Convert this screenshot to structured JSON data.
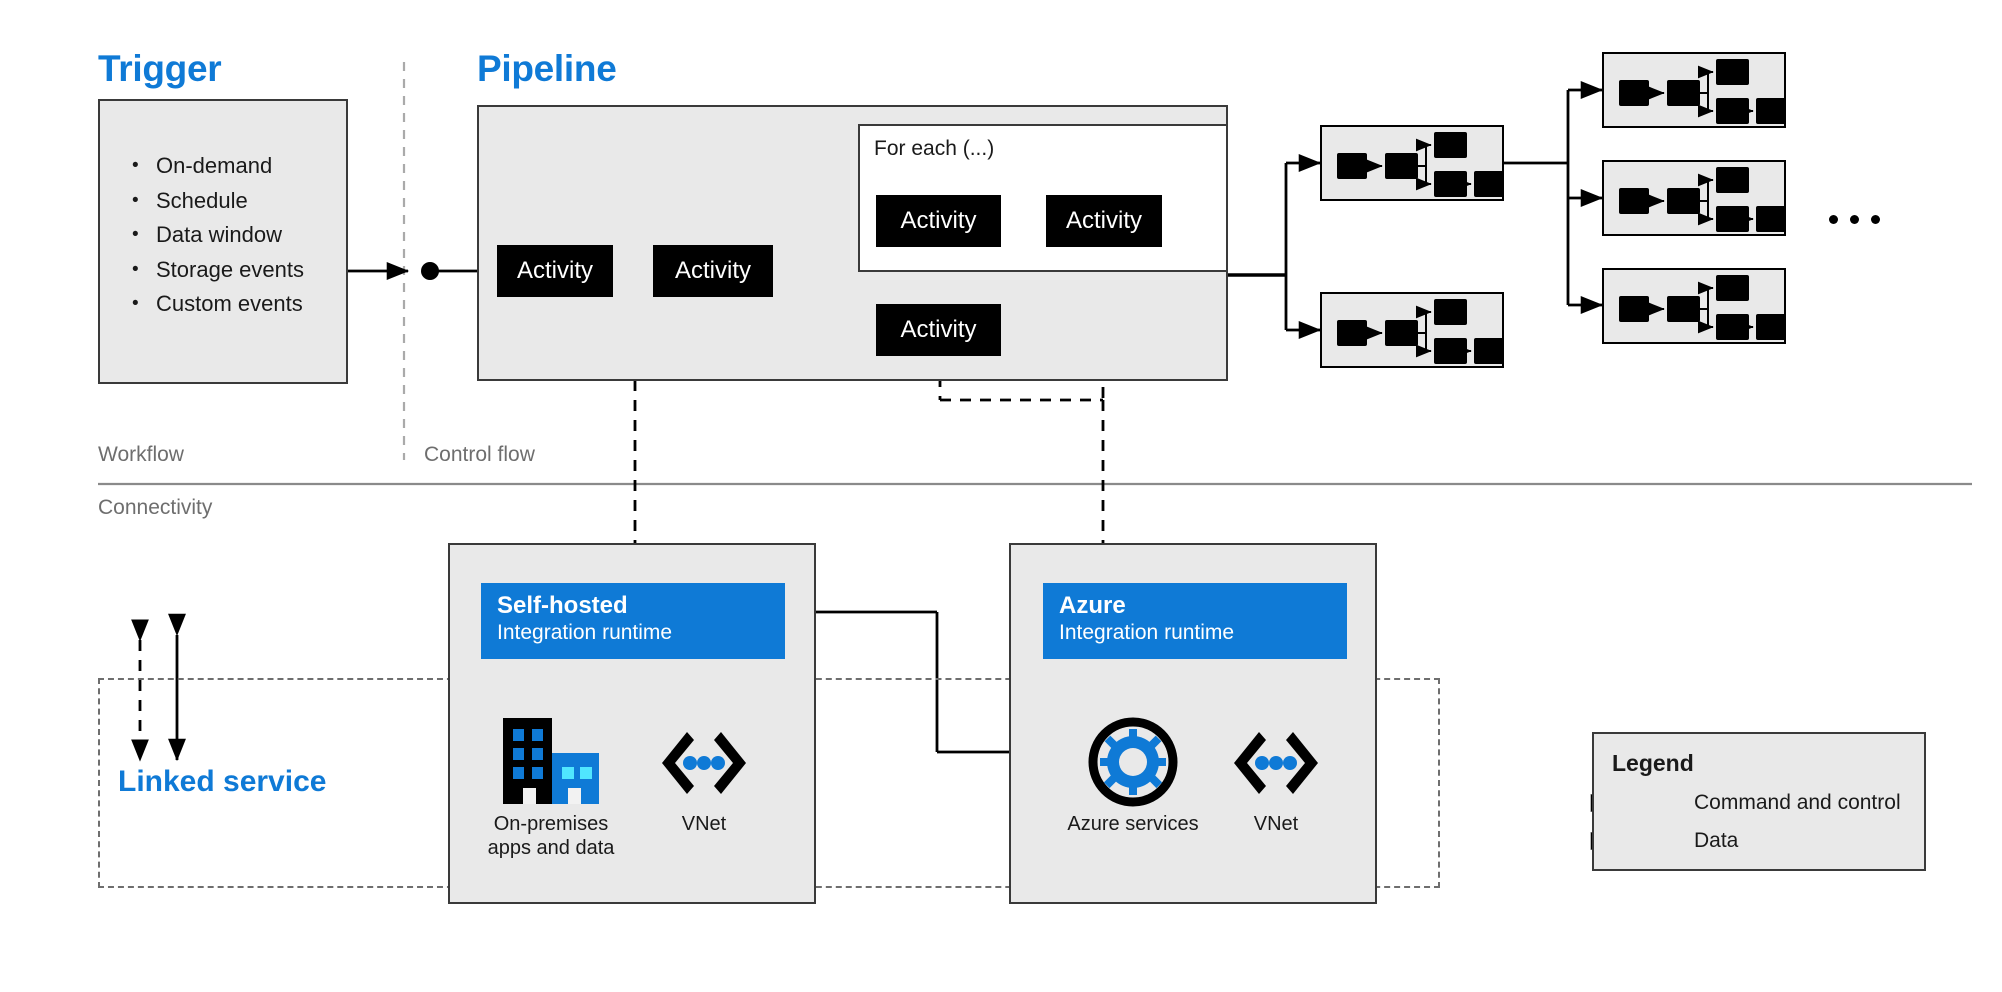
{
  "sections": {
    "trigger_title": "Trigger",
    "pipeline_title": "Pipeline"
  },
  "trigger": {
    "items": [
      "On-demand",
      "Schedule",
      "Data window",
      "Storage events",
      "Custom events"
    ]
  },
  "pipeline": {
    "foreach_label": "For each (...)",
    "activities": [
      {
        "label": "Activity"
      },
      {
        "label": "Activity"
      },
      {
        "label": "Activity"
      },
      {
        "label": "Activity"
      },
      {
        "label": "Activity"
      }
    ]
  },
  "lanes": {
    "workflow": "Workflow",
    "control_flow": "Control flow",
    "connectivity": "Connectivity"
  },
  "linked_service": {
    "title": "Linked service"
  },
  "runtimes": [
    {
      "id": "self-hosted",
      "title": "Self-hosted",
      "subtitle": "Integration runtime",
      "icons": [
        {
          "name": "on-premises-building-icon",
          "caption_line1": "On-premises",
          "caption_line2": "apps and data"
        },
        {
          "name": "vnet-icon",
          "caption_line1": "VNet",
          "caption_line2": ""
        }
      ]
    },
    {
      "id": "azure",
      "title": "Azure",
      "subtitle": "Integration runtime",
      "icons": [
        {
          "name": "azure-services-gear-icon",
          "caption_line1": "Azure services",
          "caption_line2": ""
        },
        {
          "name": "vnet-icon",
          "caption_line1": "VNet",
          "caption_line2": ""
        }
      ]
    }
  ],
  "legend": {
    "title": "Legend",
    "items": [
      {
        "style": "dashed",
        "label": "Command and control"
      },
      {
        "style": "solid",
        "label": "Data"
      }
    ]
  },
  "overflow_indicator": "• • •",
  "colors": {
    "accent_blue": "#0f7ad6",
    "icon_blue": "#0f7ad6",
    "icon_light_blue": "#50e6ff",
    "box_fill": "#e9e9e9",
    "box_stroke": "#3a3a3a",
    "node_black": "#000000",
    "lane_label_grey": "#6e6e6e"
  }
}
